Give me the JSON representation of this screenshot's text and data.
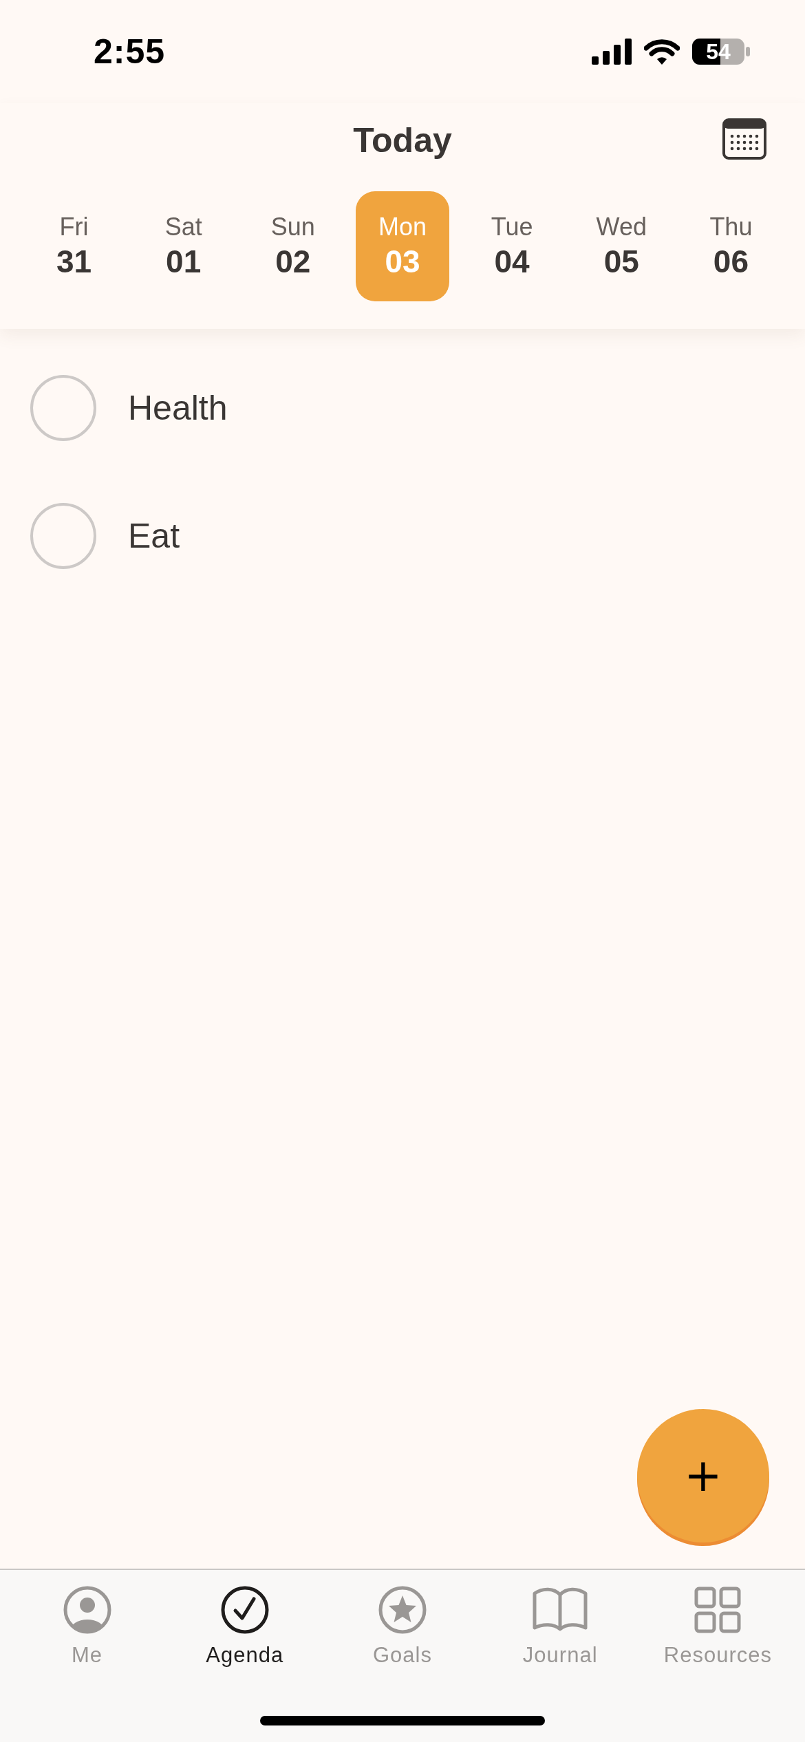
{
  "status_bar": {
    "time": "2:55",
    "battery": "54"
  },
  "header": {
    "title": "Today"
  },
  "week": [
    {
      "weekday": "Fri",
      "day": "31",
      "selected": false
    },
    {
      "weekday": "Sat",
      "day": "01",
      "selected": false
    },
    {
      "weekday": "Sun",
      "day": "02",
      "selected": false
    },
    {
      "weekday": "Mon",
      "day": "03",
      "selected": true
    },
    {
      "weekday": "Tue",
      "day": "04",
      "selected": false
    },
    {
      "weekday": "Wed",
      "day": "05",
      "selected": false
    },
    {
      "weekday": "Thu",
      "day": "06",
      "selected": false
    }
  ],
  "tasks": [
    {
      "label": "Health",
      "checked": false
    },
    {
      "label": "Eat",
      "checked": false
    }
  ],
  "fab": {
    "label": "+"
  },
  "tab_bar": [
    {
      "label": "Me",
      "selected": false
    },
    {
      "label": "Agenda",
      "selected": true
    },
    {
      "label": "Goals",
      "selected": false
    },
    {
      "label": "Journal",
      "selected": false
    },
    {
      "label": "Resources",
      "selected": false
    }
  ]
}
